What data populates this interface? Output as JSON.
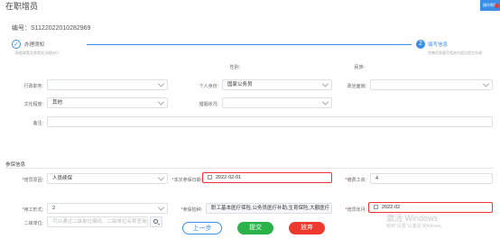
{
  "header": {
    "title": "在职增员",
    "corner_label": "操作帮助"
  },
  "serial": "编号：S1122022010282969",
  "steps": [
    {
      "index": "✓",
      "title": "办理须知",
      "subtitle": "依据政策及其相关法规执行"
    },
    {
      "index": "2",
      "title": "填写信息",
      "subtitle": "完善信息填写相关内容后提交办理"
    }
  ],
  "personal": {
    "gender_label": "性别:",
    "ethnicity_label": "民族:",
    "position_label": "行政职务:",
    "position_value": "",
    "identity_label": "个人身份:",
    "identity_value": "国家公务员",
    "political_label": "政治面貌:",
    "political_value": "",
    "education_label": "文化程度:",
    "education_value": "其他",
    "marital_label": "婚姻状况:",
    "marital_value": "",
    "remark_label": "备注:",
    "remark_value": ""
  },
  "insurance": {
    "section_title": "参保信息",
    "reason_label": "增员原因:",
    "reason_value": "人员续保",
    "this_date_label": "本次参保日期:",
    "this_date_value": "2022-02-01",
    "wage_label": "缴费工资:",
    "wage_value": "4",
    "worker_type_label": "用工形式:",
    "worker_type_value": "2",
    "types_label": "参保险种:",
    "types_value": "职工基本医疗保险,公务员医疗补助,生育保险,大额医疗",
    "increase_month_label": "增员年月:",
    "increase_month_value": "2022-02",
    "second_unit_label": "二级单位:",
    "second_unit_placeholder": "可以通过二级单位编码、二级单位名称查询"
  },
  "buttons": {
    "prev": "上一步",
    "submit": "提交",
    "abandon": "放弃"
  },
  "watermark": {
    "line1": "激活 Windows",
    "line2": "转到\"设置\"以激活 Windows。"
  },
  "colors": {
    "primary": "#3a8ee6",
    "success": "#2cb24a",
    "danger": "#ee3a2e"
  }
}
